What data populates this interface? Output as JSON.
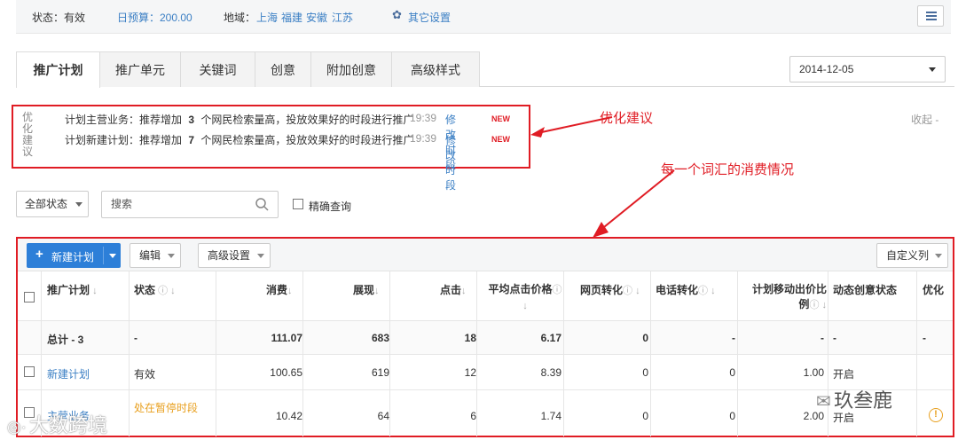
{
  "statusbar": {
    "status": "状态：有效",
    "budget": "日预算：200.00",
    "region_label": "地域：",
    "regions": [
      "上海",
      "福建",
      "安徽",
      "江苏"
    ],
    "other_settings": "其它设置"
  },
  "tabs": [
    "推广计划",
    "推广单元",
    "关键词",
    "创意",
    "附加创意",
    "高级样式"
  ],
  "date": "2014-12-05",
  "optimize": {
    "label": "优化建议",
    "rows": [
      {
        "text": "计划主营业务：推荐增加",
        "num": "3",
        "rest": "个网民检索量高，投放效果好的时段进行推广",
        "time": "19:39",
        "link": "修改时段",
        "badge": "NEW"
      },
      {
        "text": "计划新建计划：推荐增加",
        "num": "7",
        "rest": "个网民检索量高，投放效果好的时段进行推广",
        "time": "19:39",
        "link": "修改时段",
        "badge": "NEW"
      }
    ],
    "collapse": "收起 -"
  },
  "annotations": {
    "a1": "优化建议",
    "a2": "每一个词汇的消费情况"
  },
  "filters": {
    "status_select": "全部状态",
    "search_placeholder": "搜索",
    "exact": "精确查询"
  },
  "toolbar": {
    "new_plan": "新建计划",
    "edit": "编辑",
    "advanced": "高级设置",
    "custom_cols": "自定义列"
  },
  "table": {
    "headers": [
      "推广计划",
      "状态",
      "消费",
      "展现",
      "点击",
      "平均点击价格",
      "网页转化",
      "电话转化",
      "计划移动出价比例",
      "动态创意状态",
      "优化"
    ],
    "total": {
      "name": "总计 - 3",
      "status": "-",
      "cost": "111.07",
      "impr": "683",
      "clicks": "18",
      "avg": "6.17",
      "web": "0",
      "phone": "-",
      "ratio": "-",
      "dyn": "-",
      "opt": "-"
    },
    "rows": [
      {
        "name": "新建计划",
        "status": "有效",
        "cost": "100.65",
        "impr": "619",
        "clicks": "12",
        "avg": "8.39",
        "web": "0",
        "phone": "0",
        "ratio": "1.00",
        "dyn": "开启"
      },
      {
        "name": "主营业务",
        "status": "处在暂停时段",
        "cost": "10.42",
        "impr": "64",
        "clicks": "6",
        "avg": "1.74",
        "web": "0",
        "phone": "0",
        "ratio": "2.00",
        "dyn": "开启"
      }
    ]
  },
  "watermarks": {
    "left": "大数跨境",
    "right": "玖叁鹿"
  }
}
